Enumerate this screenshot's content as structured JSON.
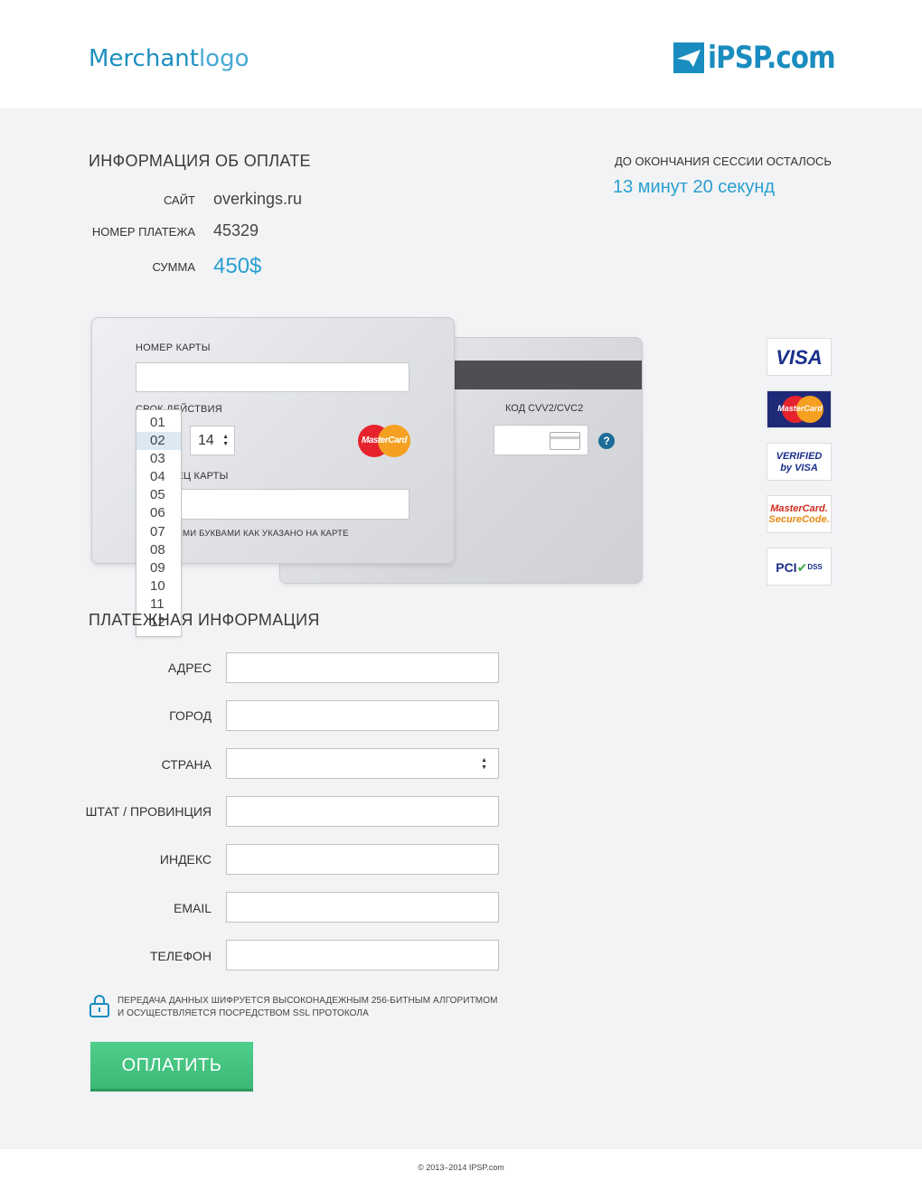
{
  "header": {
    "merchant_logo_main": "Merchant",
    "merchant_logo_light": "logo",
    "provider_logo": "iPSP.com"
  },
  "payment_info": {
    "title": "ИНФОРМАЦИЯ ОБ ОПЛАТЕ",
    "site_label": "САЙТ",
    "site_value": "overkings.ru",
    "payment_number_label": "НОМЕР ПЛАТЕЖА",
    "payment_number_value": "45329",
    "amount_label": "СУММА",
    "amount_value": "450$"
  },
  "session": {
    "label": "ДО ОКОНЧАНИЯ СЕССИИ ОСТАЛОСЬ",
    "value": "13 минут 20 секунд"
  },
  "card_front": {
    "card_number_label": "НОМЕР КАРТЫ",
    "card_number_value": "",
    "expiry_label": "СРОК ДЕЙСТВИЯ",
    "expiry_year": "14",
    "holder_label": "ВЛАДЕЛЕЦ КАРТЫ",
    "holder_value": "",
    "holder_hint": "ЛАТИНСКИМИ БУКВАМИ КАК УКАЗАНО НА КАРТЕ",
    "brand": "MasterCard"
  },
  "card_back": {
    "cvv_label": "КОД CVV2/CVC2",
    "cvv_value": "",
    "help": "?"
  },
  "month_dropdown": {
    "options": [
      "01",
      "02",
      "03",
      "04",
      "05",
      "06",
      "07",
      "08",
      "09",
      "10",
      "11",
      "12"
    ],
    "selected": "02"
  },
  "badges": {
    "visa": "VISA",
    "mastercard": "MasterCard",
    "verified_line1": "VERIFIED",
    "verified_line2": "by VISA",
    "mc_secure_line1": "MasterCard.",
    "mc_secure_line2": "SecureCode.",
    "pci": "PCI",
    "pci_dss": "DSS"
  },
  "billing": {
    "title": "ПЛАТЕЖНАЯ ИНФОРМАЦИЯ",
    "address_label": "АДРЕС",
    "city_label": "ГОРОД",
    "country_label": "СТРАНА",
    "state_label": "ШТАТ / ПРОВИНЦИЯ",
    "zip_label": "ИНДЕКС",
    "email_label": "EMAIL",
    "phone_label": "ТЕЛЕФОН"
  },
  "security": {
    "line1": "ПЕРЕДАЧА ДАННЫХ ШИФРУЕТСЯ ВЫСОКОНАДЕЖНЫМ 256-БИТНЫМ АЛГОРИТМОМ",
    "line2": "И ОСУЩЕСТВЛЯЕТСЯ ПОСРЕДСТВОМ SSL ПРОТОКОЛА"
  },
  "pay_button": "ОПЛАТИТЬ",
  "footer": "© 2013–2014 IPSP.com",
  "colors": {
    "accent": "#2a9fd0",
    "button": "#3bb875",
    "stripe": "#4e4f53"
  }
}
